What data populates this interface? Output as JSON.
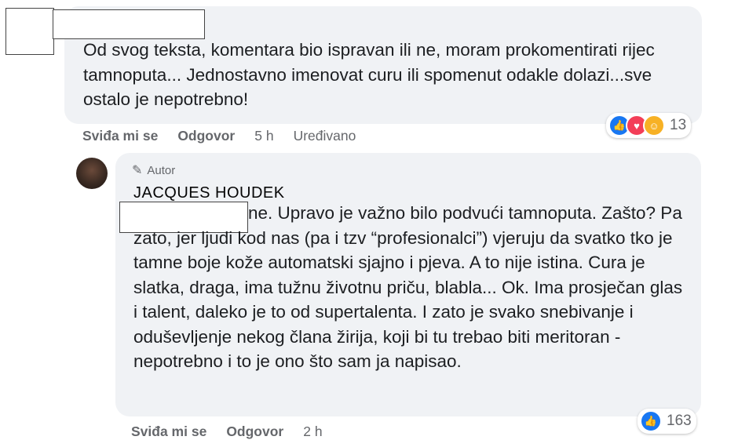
{
  "comment1": {
    "text": "Od svog teksta, komentara bio ispravan ili ne, moram prokomentirati rijec tamnoputa... Jednostavno imenovat curu ili spomenut odakle dolazi...sve ostalo je nepotrebno!",
    "actions": {
      "like": "Sviđa mi se",
      "reply": "Odgovor",
      "time": "5 h",
      "edited": "Uređivano"
    },
    "reactions": {
      "count": "13",
      "icons": [
        "like-icon",
        "love-icon",
        "care-icon"
      ]
    }
  },
  "comment2": {
    "badge": "Autor",
    "author": "JACQUES HOUDEK",
    "text": "ne. Upravo je važno bilo podvući tamnoputa. Zašto? Pa zato, jer ljudi kod nas (pa i tzv “profesionalci”) vjeruju da svatko tko je tamne boje kože automatski sjajno i pjeva. A to nije istina. Cura je slatka, draga, ima tužnu životnu priču, blabla... Ok. Ima prosječan glas i talent, daleko je to od supertalenta. I zato je svako snebivanje i oduševljenje nekog člana žirija, koji bi tu trebao biti meritoran - nepotrebno i to je ono što sam ja napisao.",
    "actions": {
      "like": "Sviđa mi se",
      "reply": "Odgovor",
      "time": "2 h"
    },
    "reactions": {
      "count": "163",
      "icons": [
        "like-icon"
      ]
    }
  },
  "colors": {
    "bubble": "#f0f2f5",
    "like": "#1877f2",
    "love": "#f33e58",
    "care": "#f7b125",
    "meta": "#65676b"
  }
}
